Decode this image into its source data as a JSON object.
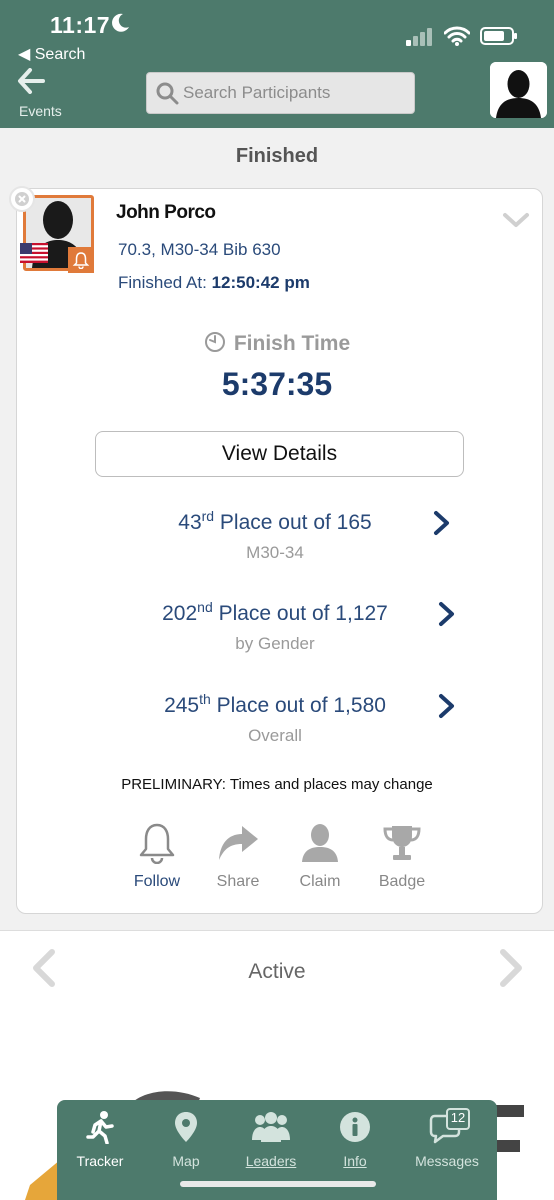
{
  "status_bar": {
    "time": "11:17",
    "back_app": "◀ Search"
  },
  "header": {
    "back_label": "Events",
    "search_placeholder": "Search Participants"
  },
  "section_title": "Finished",
  "athlete": {
    "name": "John Porco",
    "division": "70.3, M30-34 Bib 630",
    "finished_at_label": "Finished At:",
    "finished_at_value": "12:50:42 pm",
    "finish_time_label": "Finish Time",
    "finish_time": "5:37:35"
  },
  "view_details_label": "View Details",
  "places": [
    {
      "rank": "43",
      "suffix": "rd",
      "text": " Place out of 165",
      "sub": "M30-34"
    },
    {
      "rank": "202",
      "suffix": "nd",
      "text": " Place out of 1,127",
      "sub": "by Gender"
    },
    {
      "rank": "245",
      "suffix": "th",
      "text": " Place out of 1,580",
      "sub": "Overall"
    }
  ],
  "preliminary_note": "PRELIMINARY: Times and places may change",
  "actions": {
    "follow": "Follow",
    "share": "Share",
    "claim": "Claim",
    "badge": "Badge"
  },
  "active_title": "Active",
  "tabs": {
    "tracker": "Tracker",
    "map": "Map",
    "leaders": "Leaders",
    "info": "Info",
    "messages": "Messages"
  },
  "messages_count": "12",
  "colors": {
    "header_green": "#4d7a6c",
    "accent_orange": "#e07a3a",
    "navy": "#1c3b6b"
  }
}
